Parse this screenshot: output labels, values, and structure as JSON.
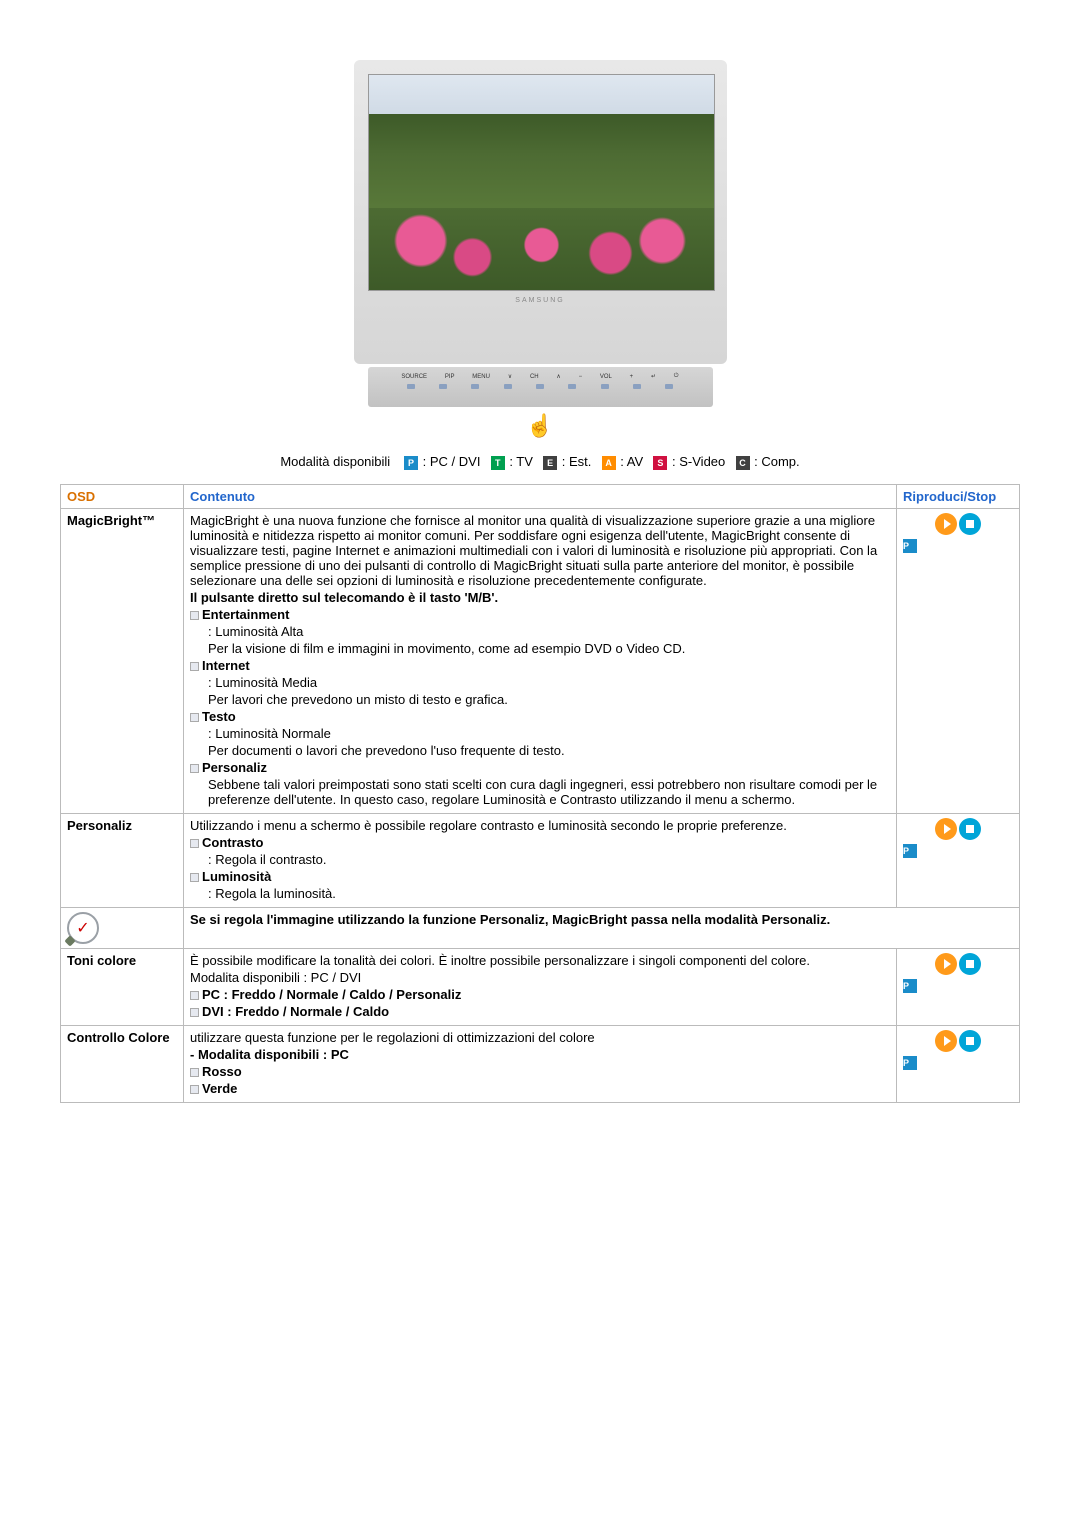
{
  "monitor": {
    "brand_label": "SAMSUNG",
    "buttons": {
      "source": "SOURCE",
      "pip": "PIP",
      "menu": "MENU",
      "ch_down": "∨",
      "ch_label": "CH",
      "ch_up": "∧",
      "vol_minus": "−",
      "vol_label": "VOL",
      "vol_plus": "+",
      "enter": "↵",
      "power": "⏻"
    }
  },
  "modes_line": {
    "prefix": "Modalità disponibili",
    "items": [
      {
        "badge": "P",
        "label": ": PC / DVI"
      },
      {
        "badge": "T",
        "label": ": TV"
      },
      {
        "badge": "E",
        "label": ": Est."
      },
      {
        "badge": "A",
        "label": ": AV"
      },
      {
        "badge": "S",
        "label": ": S-Video"
      },
      {
        "badge": "C",
        "label": ": Comp."
      }
    ]
  },
  "headers": {
    "osd": "OSD",
    "content": "Contenuto",
    "play_stop": "Riproduci/Stop"
  },
  "rows": {
    "magicbright": {
      "title": "MagicBright™",
      "p1": "MagicBright è una nuova funzione che fornisce al monitor una qualità di visualizzazione superiore grazie a una migliore luminosità e nitidezza rispetto ai monitor comuni. Per soddisfare ogni esigenza dell'utente, MagicBright consente di visualizzare testi, pagine Internet e animazioni multimediali con i valori di luminosità e risoluzione più appropriati. Con la semplice pressione di uno dei pulsanti di controllo di MagicBright situati sulla parte anteriore del monitor, è possibile selezionare una delle sei opzioni di luminosità e risoluzione precedentemente configurate.",
      "p2": "Il pulsante diretto sul telecomando è il tasto 'M/B'.",
      "ent_title": "Entertainment",
      "ent_l1": ": Luminosità Alta",
      "ent_l2": "Per la visione di film e immagini in movimento, come ad esempio DVD o Video CD.",
      "int_title": "Internet",
      "int_l1": ": Luminosità Media",
      "int_l2": "Per lavori che prevedono un misto di testo e grafica.",
      "tes_title": "Testo",
      "tes_l1": ": Luminosità Normale",
      "tes_l2": "Per documenti o lavori che prevedono l'uso frequente di testo.",
      "per_title": "Personaliz",
      "per_l1": "Sebbene tali valori preimpostati sono stati scelti con cura dagli ingegneri, essi potrebbero non risultare comodi per le preferenze dell'utente. In questo caso, regolare Luminosità e Contrasto utilizzando il menu a schermo."
    },
    "personaliz": {
      "title": "Personaliz",
      "p1": "Utilizzando i menu a schermo è possibile regolare contrasto e luminosità secondo le proprie preferenze.",
      "c_title": "Contrasto",
      "c_l1": ": Regola il contrasto.",
      "l_title": "Luminosità",
      "l_l1": ": Regola la luminosità."
    },
    "note": {
      "text": "Se si regola l'immagine utilizzando la funzione Personaliz, MagicBright passa nella modalità Personaliz."
    },
    "tonicolore": {
      "title": "Toni colore",
      "p1": "È possibile modificare la tonalità dei colori. È inoltre possibile personalizzare i singoli componenti del colore.",
      "p2": "Modalita disponibili : PC / DVI",
      "pc": "PC : Freddo / Normale / Caldo / Personaliz",
      "dvi": "DVI : Freddo / Normale / Caldo"
    },
    "controllo": {
      "title": "Controllo Colore",
      "p1": "utilizzare questa funzione per le regolazioni di ottimizzazioni del colore",
      "p2": "- Modalita disponibili : PC",
      "rosso": "Rosso",
      "verde": "Verde"
    }
  }
}
